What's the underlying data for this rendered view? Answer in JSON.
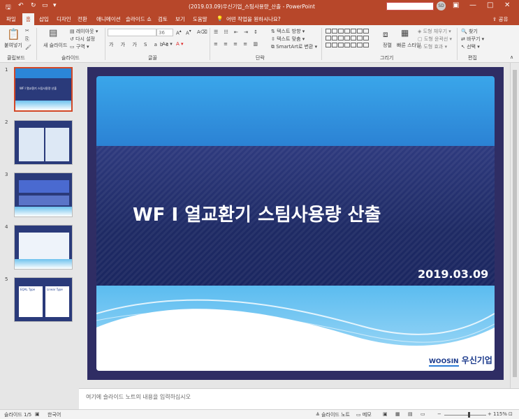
{
  "window": {
    "title": "(2019.03.09)우신기업_스팀사용량_산출  -  PowerPoint",
    "user_initials": "SD",
    "minimize": "—",
    "maximize": "□",
    "close": "✕"
  },
  "tabs": [
    {
      "label": "파일"
    },
    {
      "label": "홈"
    },
    {
      "label": "삽입"
    },
    {
      "label": "디자인"
    },
    {
      "label": "전환"
    },
    {
      "label": "애니메이션"
    },
    {
      "label": "슬라이드 쇼"
    },
    {
      "label": "검토"
    },
    {
      "label": "보기"
    },
    {
      "label": "도움말"
    },
    {
      "label": "어떤 작업을 원하시나요?"
    }
  ],
  "share_label": "공유",
  "ribbon": {
    "paste": "붙여넣기",
    "new_slide": "새 슬라이드",
    "layout": "레이아웃",
    "reset": "다시 설정",
    "section": "구역",
    "font_size": "36",
    "text_direction": "텍스트 방향",
    "align_text": "텍스트 맞춤",
    "smartart": "SmartArt로 변환",
    "arrange": "정렬",
    "quick_styles": "빠른 스타일",
    "shape_fill": "도형 채우기",
    "shape_outline": "도형 윤곽선",
    "shape_effects": "도형 효과",
    "find": "찾기",
    "replace": "바꾸기",
    "select": "선택",
    "groups": {
      "clipboard": "클립보드",
      "slides": "슬라이드",
      "font": "글꼴",
      "paragraph": "단락",
      "drawing": "그리기",
      "editing": "편집"
    }
  },
  "thumbnails": [
    {
      "num": "1",
      "text": "WF I 열교환기 스팀사용량 산출"
    },
    {
      "num": "2",
      "text": ""
    },
    {
      "num": "3",
      "text": ""
    },
    {
      "num": "4",
      "text": ""
    },
    {
      "num": "5",
      "text": ""
    }
  ],
  "thumb5": {
    "label_a": "EQAL Type",
    "label_b": "Linear Type"
  },
  "slide": {
    "title": "WF I 열교환기 스팀사용량 산출",
    "date": "2019.03.09",
    "logo_word": "WOOSIN",
    "logo_name": "우신기업"
  },
  "notes_placeholder": "여기에 슬라이드 노트의 내용을 입력하십시오",
  "status": {
    "slide_counter": "슬라이드 1/5",
    "language": "한국어",
    "notes_btn": "슬라이드 노트",
    "comments_btn": "메모",
    "zoom": "115%",
    "zoom_level": 0.58
  },
  "colors": {
    "accent": "#b7472a",
    "slide_bg": "#1f2f66",
    "selected_thumb": "#d24726"
  }
}
